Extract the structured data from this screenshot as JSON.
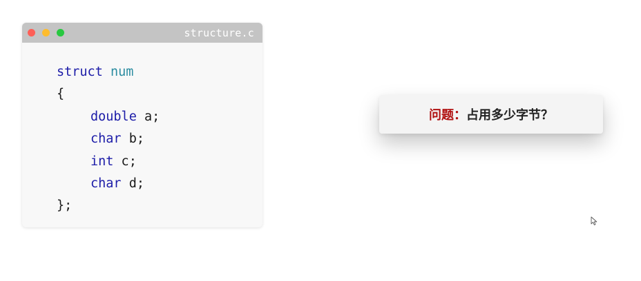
{
  "editor": {
    "filename": "structure.c",
    "code": {
      "line1_keyword": "struct",
      "line1_name": "num",
      "line2": "{",
      "line3_type": "double",
      "line3_rest": " a;",
      "line4_type": "char",
      "line4_rest": " b;",
      "line5_type": "int",
      "line5_rest": " c;",
      "line6_type": "char",
      "line6_rest": " d;",
      "line7": "};"
    }
  },
  "question": {
    "label": "问题：",
    "text": "占用多少字节？"
  },
  "colors": {
    "keyword": "#1c1ca8",
    "type_name": "#2b8ca0",
    "question_label": "#b01010"
  },
  "icons": [
    "close-dot",
    "minimize-dot",
    "maximize-dot",
    "mouse-cursor-icon"
  ]
}
